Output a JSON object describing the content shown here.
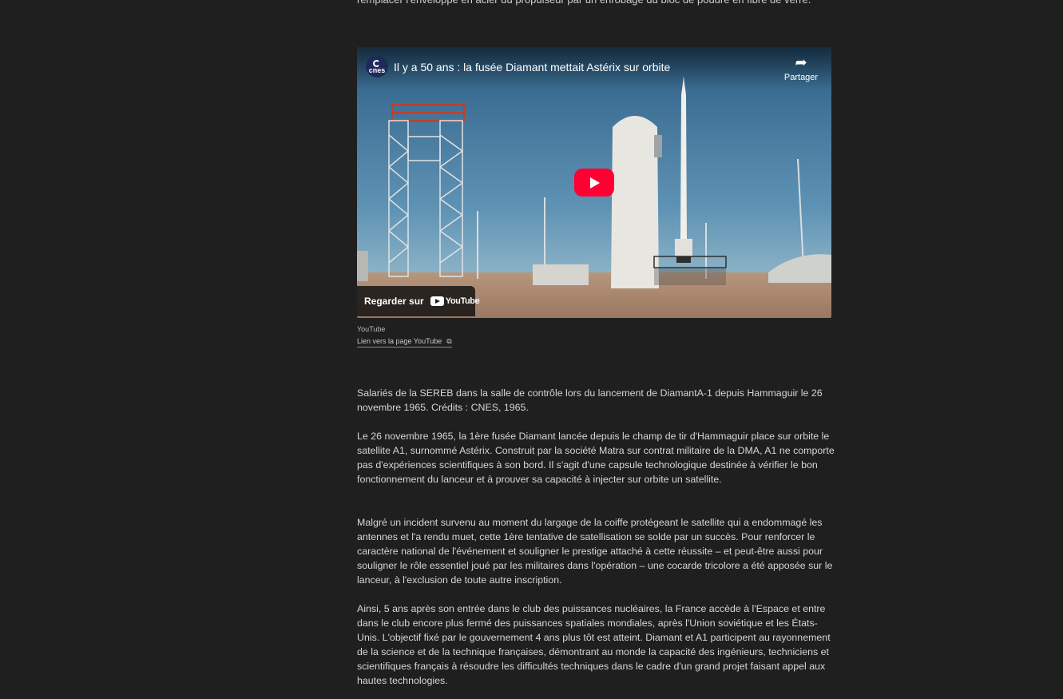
{
  "article": {
    "top_text": "remplacer l'enveloppe en acier du propulseur par un enrobage du bloc de poudre en fibre de verre.",
    "paragraphs": [
      "Salariés de la SEREB dans la salle de contrôle lors du lancement de DiamantA-1 depuis Hammaguir le 26 novembre 1965. Crédits : CNES, 1965.",
      "Le 26 novembre 1965, la 1ère fusée Diamant lancée depuis le champ de tir d'Hammaguir place sur orbite le satellite A1, surnommé Astérix. Construit par la société Matra sur contrat militaire de la DMA, A1 ne comporte pas d'expériences scientifiques à son bord. Il s'agit d'une capsule technologique destinée à vérifier le bon fonctionnement du lanceur et à prouver sa capacité à injecter sur orbite un satellite.",
      "Malgré un incident survenu au moment du largage de la coiffe protégeant le satellite qui a endommagé les antennes et l'a rendu muet, cette 1ère tentative de satellisation se solde par un succès. Pour renforcer le caractère national de l'événement et souligner le prestige attaché à cette réussite – et peut-être aussi pour souligner le rôle essentiel joué par les militaires dans l'opération – une cocarde tricolore a été apposée sur le lanceur, à l'exclusion de toute autre inscription.",
      "Ainsi, 5 ans après son entrée dans le club des puissances nucléaires, la France accède à l'Espace et entre dans le club encore plus fermé des puissances spatiales mondiales, après l'Union soviétique et les États-Unis. L'objectif fixé par le gouvernement 4 ans plus tôt est atteint. Diamant et A1 participent au rayonnement de la science et de la technique françaises, démontrant au monde  la capacité des ingénieurs, techniciens et scientifiques français à résoudre les difficultés techniques dans le cadre d'un grand projet faisant appel aux hautes technologies."
    ]
  },
  "video": {
    "channel_logo_text": "cnes",
    "title": "Il y a 50 ans : la fusée Diamant mettait Astérix sur orbite",
    "share_label": "Partager",
    "watch_on_label": "Regarder sur",
    "youtube_brand": "YouTube",
    "play_color": "#ff0033"
  },
  "embed_source": {
    "provider": "YouTube",
    "link_label": "Lien vers la page YouTube"
  }
}
